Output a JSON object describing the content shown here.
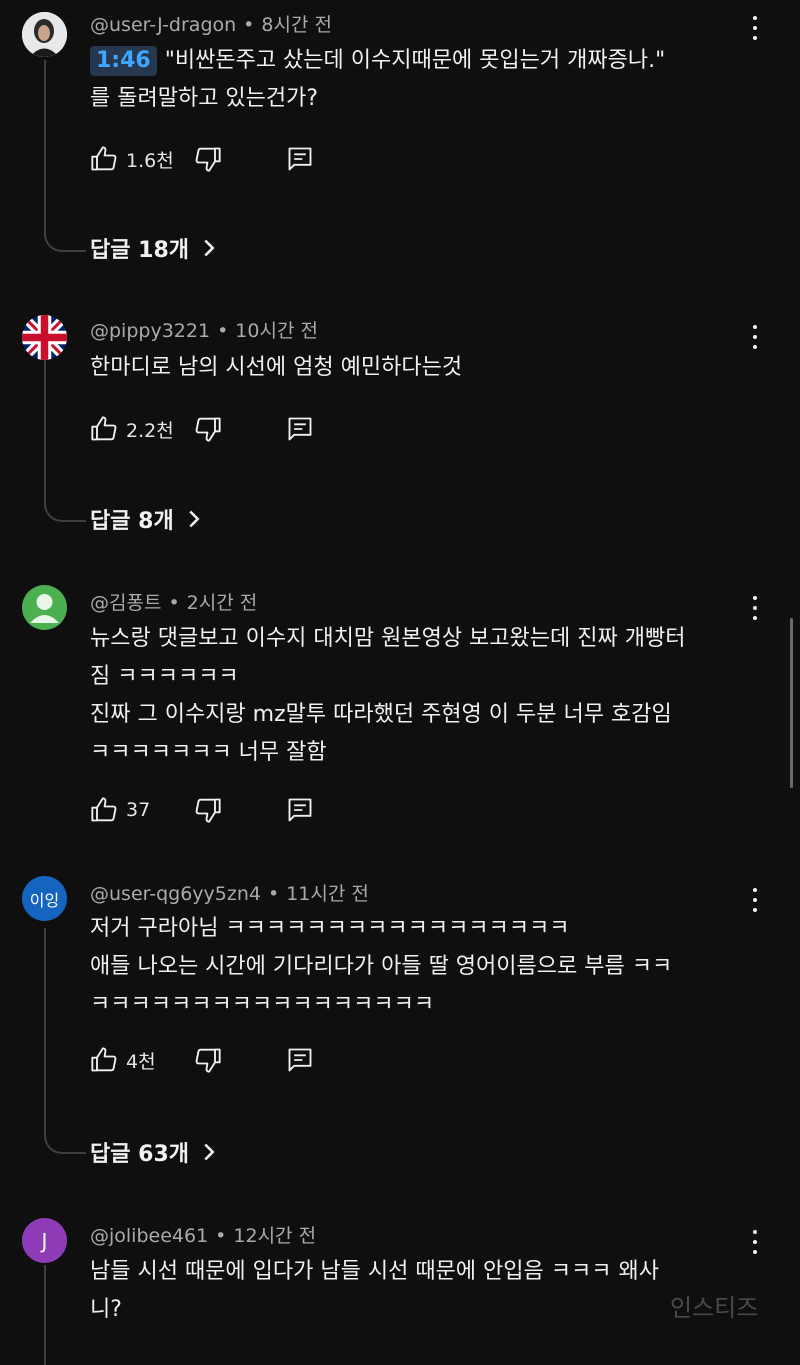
{
  "comments": [
    {
      "author": "@user-J-dragon",
      "time": "8시간 전",
      "timestamp_link": "1:46",
      "lines": [
        "\"비싼돈주고 샀는데 이수지때문에 못입는거 개짜증나.\"",
        "를 돌려말하고 있는건가?"
      ],
      "likes": "1.6천",
      "replies": "답글 18개",
      "avatar_icon": "portrait-photo"
    },
    {
      "author": "@pippy3221",
      "time": "10시간 전",
      "lines": [
        "한마디로 남의 시선에 엄청 예민하다는것"
      ],
      "likes": "2.2천",
      "replies": "답글 8개",
      "avatar_icon": "union-jack-flag"
    },
    {
      "author": "@김퐁트",
      "time": "2시간 전",
      "lines": [
        "뉴스랑 댓글보고 이수지 대치맘 원본영상 보고왔는데 진짜 개빵터",
        "짐 ㅋㅋㅋㅋㅋㅋ",
        "진짜 그 이수지랑 mz말투 따라했던 주현영 이 두분 너무 호감임",
        "ㅋㅋㅋㅋㅋㅋㅋ 너무 잘함"
      ],
      "likes": "37",
      "avatar_icon": "default-user-silhouette",
      "avatar_color": "#4caf50"
    },
    {
      "author": "@user-qg6yy5zn4",
      "time": "11시간 전",
      "lines": [
        "저거 구라아님 ㅋㅋㅋㅋㅋㅋㅋㅋㅋㅋㅋㅋㅋㅋㅋㅋㅋ",
        "애들 나오는 시간에 기다리다가 아들 딸 영어이름으로 부름 ㅋㅋ",
        "ㅋㅋㅋㅋㅋㅋㅋㅋㅋㅋㅋㅋㅋㅋㅋㅋㅋ"
      ],
      "likes": "4천",
      "replies": "답글 63개",
      "avatar_text": "이잉",
      "avatar_color": "#1565c0"
    },
    {
      "author": "@jolibee461",
      "time": "12시간 전",
      "lines": [
        "남들 시선 때문에 입다가 남들 시선 때문에 안입음 ㅋㅋㅋ 왜사",
        "니?"
      ],
      "avatar_text": "J",
      "avatar_color": "#8e3bb7"
    }
  ],
  "watermark": "인스티즈",
  "colors": {
    "background": "#0f0f0f",
    "text": "#f1f1f1",
    "meta": "#aaaaaa",
    "timestamp_link": "#3ea6ff"
  }
}
